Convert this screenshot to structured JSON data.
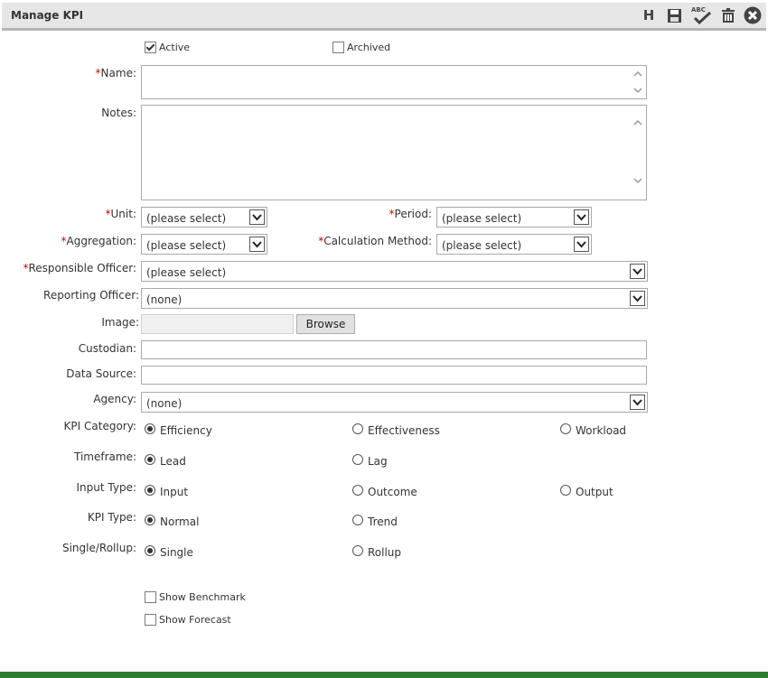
{
  "window": {
    "title": "Manage KPI",
    "toolbar": [
      {
        "name": "history-h-icon",
        "glyph": "H"
      },
      {
        "name": "save-icon"
      },
      {
        "name": "spellcheck-icon",
        "text": "ABC"
      },
      {
        "name": "delete-icon"
      },
      {
        "name": "close-icon"
      }
    ]
  },
  "status": {
    "active_label": "Active",
    "active_checked": true,
    "archived_label": "Archived",
    "archived_checked": false
  },
  "fields": {
    "required_mark": "*",
    "name_label": "Name:",
    "notes_label": "Notes:",
    "unit_label": "Unit:",
    "unit_value": "(please select)",
    "period_label": "Period:",
    "period_value": "(please select)",
    "aggregation_label": "Aggregation:",
    "aggregation_value": "(please select)",
    "calc_label": "Calculation Method:",
    "calc_value": "(please select)",
    "resp_label": "Responsible Officer:",
    "resp_value": "(please select)",
    "report_label": "Reporting Officer:",
    "report_value": "(none)",
    "image_label": "Image:",
    "browse_label": "Browse",
    "custodian_label": "Custodian:",
    "datasource_label": "Data Source:",
    "agency_label": "Agency:",
    "agency_value": "(none)"
  },
  "radios": {
    "category_label": "KPI Category:",
    "category_options": [
      "Efficiency",
      "Effectiveness",
      "Workload"
    ],
    "category_selected": "Efficiency",
    "timeframe_label": "Timeframe:",
    "timeframe_options": [
      "Lead",
      "Lag"
    ],
    "timeframe_selected": "Lead",
    "input_label": "Input Type:",
    "input_options": [
      "Input",
      "Outcome",
      "Output"
    ],
    "input_selected": "Input",
    "kpitype_label": "KPI Type:",
    "kpitype_options": [
      "Normal",
      "Trend"
    ],
    "kpitype_selected": "Normal",
    "rollup_label": "Single/Rollup:",
    "rollup_options": [
      "Single",
      "Rollup"
    ],
    "rollup_selected": "Single"
  },
  "options": {
    "benchmark_label": "Show Benchmark",
    "benchmark_checked": false,
    "forecast_label": "Show Forecast",
    "forecast_checked": false
  },
  "colors": {
    "required": "#cc0000",
    "footer": "#2e7d32",
    "titlebar": "#e6e6e6"
  }
}
